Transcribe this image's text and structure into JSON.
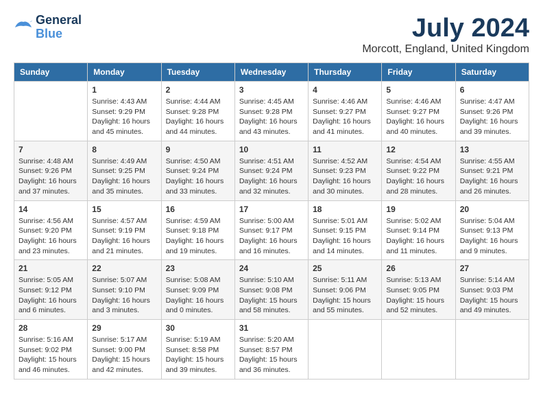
{
  "header": {
    "logo_line1": "General",
    "logo_line2": "Blue",
    "month": "July 2024",
    "location": "Morcott, England, United Kingdom"
  },
  "weekdays": [
    "Sunday",
    "Monday",
    "Tuesday",
    "Wednesday",
    "Thursday",
    "Friday",
    "Saturday"
  ],
  "weeks": [
    [
      {
        "day": "",
        "sunrise": "",
        "sunset": "",
        "daylight": ""
      },
      {
        "day": "1",
        "sunrise": "Sunrise: 4:43 AM",
        "sunset": "Sunset: 9:29 PM",
        "daylight": "Daylight: 16 hours and 45 minutes."
      },
      {
        "day": "2",
        "sunrise": "Sunrise: 4:44 AM",
        "sunset": "Sunset: 9:28 PM",
        "daylight": "Daylight: 16 hours and 44 minutes."
      },
      {
        "day": "3",
        "sunrise": "Sunrise: 4:45 AM",
        "sunset": "Sunset: 9:28 PM",
        "daylight": "Daylight: 16 hours and 43 minutes."
      },
      {
        "day": "4",
        "sunrise": "Sunrise: 4:46 AM",
        "sunset": "Sunset: 9:27 PM",
        "daylight": "Daylight: 16 hours and 41 minutes."
      },
      {
        "day": "5",
        "sunrise": "Sunrise: 4:46 AM",
        "sunset": "Sunset: 9:27 PM",
        "daylight": "Daylight: 16 hours and 40 minutes."
      },
      {
        "day": "6",
        "sunrise": "Sunrise: 4:47 AM",
        "sunset": "Sunset: 9:26 PM",
        "daylight": "Daylight: 16 hours and 39 minutes."
      }
    ],
    [
      {
        "day": "7",
        "sunrise": "Sunrise: 4:48 AM",
        "sunset": "Sunset: 9:26 PM",
        "daylight": "Daylight: 16 hours and 37 minutes."
      },
      {
        "day": "8",
        "sunrise": "Sunrise: 4:49 AM",
        "sunset": "Sunset: 9:25 PM",
        "daylight": "Daylight: 16 hours and 35 minutes."
      },
      {
        "day": "9",
        "sunrise": "Sunrise: 4:50 AM",
        "sunset": "Sunset: 9:24 PM",
        "daylight": "Daylight: 16 hours and 33 minutes."
      },
      {
        "day": "10",
        "sunrise": "Sunrise: 4:51 AM",
        "sunset": "Sunset: 9:24 PM",
        "daylight": "Daylight: 16 hours and 32 minutes."
      },
      {
        "day": "11",
        "sunrise": "Sunrise: 4:52 AM",
        "sunset": "Sunset: 9:23 PM",
        "daylight": "Daylight: 16 hours and 30 minutes."
      },
      {
        "day": "12",
        "sunrise": "Sunrise: 4:54 AM",
        "sunset": "Sunset: 9:22 PM",
        "daylight": "Daylight: 16 hours and 28 minutes."
      },
      {
        "day": "13",
        "sunrise": "Sunrise: 4:55 AM",
        "sunset": "Sunset: 9:21 PM",
        "daylight": "Daylight: 16 hours and 26 minutes."
      }
    ],
    [
      {
        "day": "14",
        "sunrise": "Sunrise: 4:56 AM",
        "sunset": "Sunset: 9:20 PM",
        "daylight": "Daylight: 16 hours and 23 minutes."
      },
      {
        "day": "15",
        "sunrise": "Sunrise: 4:57 AM",
        "sunset": "Sunset: 9:19 PM",
        "daylight": "Daylight: 16 hours and 21 minutes."
      },
      {
        "day": "16",
        "sunrise": "Sunrise: 4:59 AM",
        "sunset": "Sunset: 9:18 PM",
        "daylight": "Daylight: 16 hours and 19 minutes."
      },
      {
        "day": "17",
        "sunrise": "Sunrise: 5:00 AM",
        "sunset": "Sunset: 9:17 PM",
        "daylight": "Daylight: 16 hours and 16 minutes."
      },
      {
        "day": "18",
        "sunrise": "Sunrise: 5:01 AM",
        "sunset": "Sunset: 9:15 PM",
        "daylight": "Daylight: 16 hours and 14 minutes."
      },
      {
        "day": "19",
        "sunrise": "Sunrise: 5:02 AM",
        "sunset": "Sunset: 9:14 PM",
        "daylight": "Daylight: 16 hours and 11 minutes."
      },
      {
        "day": "20",
        "sunrise": "Sunrise: 5:04 AM",
        "sunset": "Sunset: 9:13 PM",
        "daylight": "Daylight: 16 hours and 9 minutes."
      }
    ],
    [
      {
        "day": "21",
        "sunrise": "Sunrise: 5:05 AM",
        "sunset": "Sunset: 9:12 PM",
        "daylight": "Daylight: 16 hours and 6 minutes."
      },
      {
        "day": "22",
        "sunrise": "Sunrise: 5:07 AM",
        "sunset": "Sunset: 9:10 PM",
        "daylight": "Daylight: 16 hours and 3 minutes."
      },
      {
        "day": "23",
        "sunrise": "Sunrise: 5:08 AM",
        "sunset": "Sunset: 9:09 PM",
        "daylight": "Daylight: 16 hours and 0 minutes."
      },
      {
        "day": "24",
        "sunrise": "Sunrise: 5:10 AM",
        "sunset": "Sunset: 9:08 PM",
        "daylight": "Daylight: 15 hours and 58 minutes."
      },
      {
        "day": "25",
        "sunrise": "Sunrise: 5:11 AM",
        "sunset": "Sunset: 9:06 PM",
        "daylight": "Daylight: 15 hours and 55 minutes."
      },
      {
        "day": "26",
        "sunrise": "Sunrise: 5:13 AM",
        "sunset": "Sunset: 9:05 PM",
        "daylight": "Daylight: 15 hours and 52 minutes."
      },
      {
        "day": "27",
        "sunrise": "Sunrise: 5:14 AM",
        "sunset": "Sunset: 9:03 PM",
        "daylight": "Daylight: 15 hours and 49 minutes."
      }
    ],
    [
      {
        "day": "28",
        "sunrise": "Sunrise: 5:16 AM",
        "sunset": "Sunset: 9:02 PM",
        "daylight": "Daylight: 15 hours and 46 minutes."
      },
      {
        "day": "29",
        "sunrise": "Sunrise: 5:17 AM",
        "sunset": "Sunset: 9:00 PM",
        "daylight": "Daylight: 15 hours and 42 minutes."
      },
      {
        "day": "30",
        "sunrise": "Sunrise: 5:19 AM",
        "sunset": "Sunset: 8:58 PM",
        "daylight": "Daylight: 15 hours and 39 minutes."
      },
      {
        "day": "31",
        "sunrise": "Sunrise: 5:20 AM",
        "sunset": "Sunset: 8:57 PM",
        "daylight": "Daylight: 15 hours and 36 minutes."
      },
      {
        "day": "",
        "sunrise": "",
        "sunset": "",
        "daylight": ""
      },
      {
        "day": "",
        "sunrise": "",
        "sunset": "",
        "daylight": ""
      },
      {
        "day": "",
        "sunrise": "",
        "sunset": "",
        "daylight": ""
      }
    ]
  ]
}
